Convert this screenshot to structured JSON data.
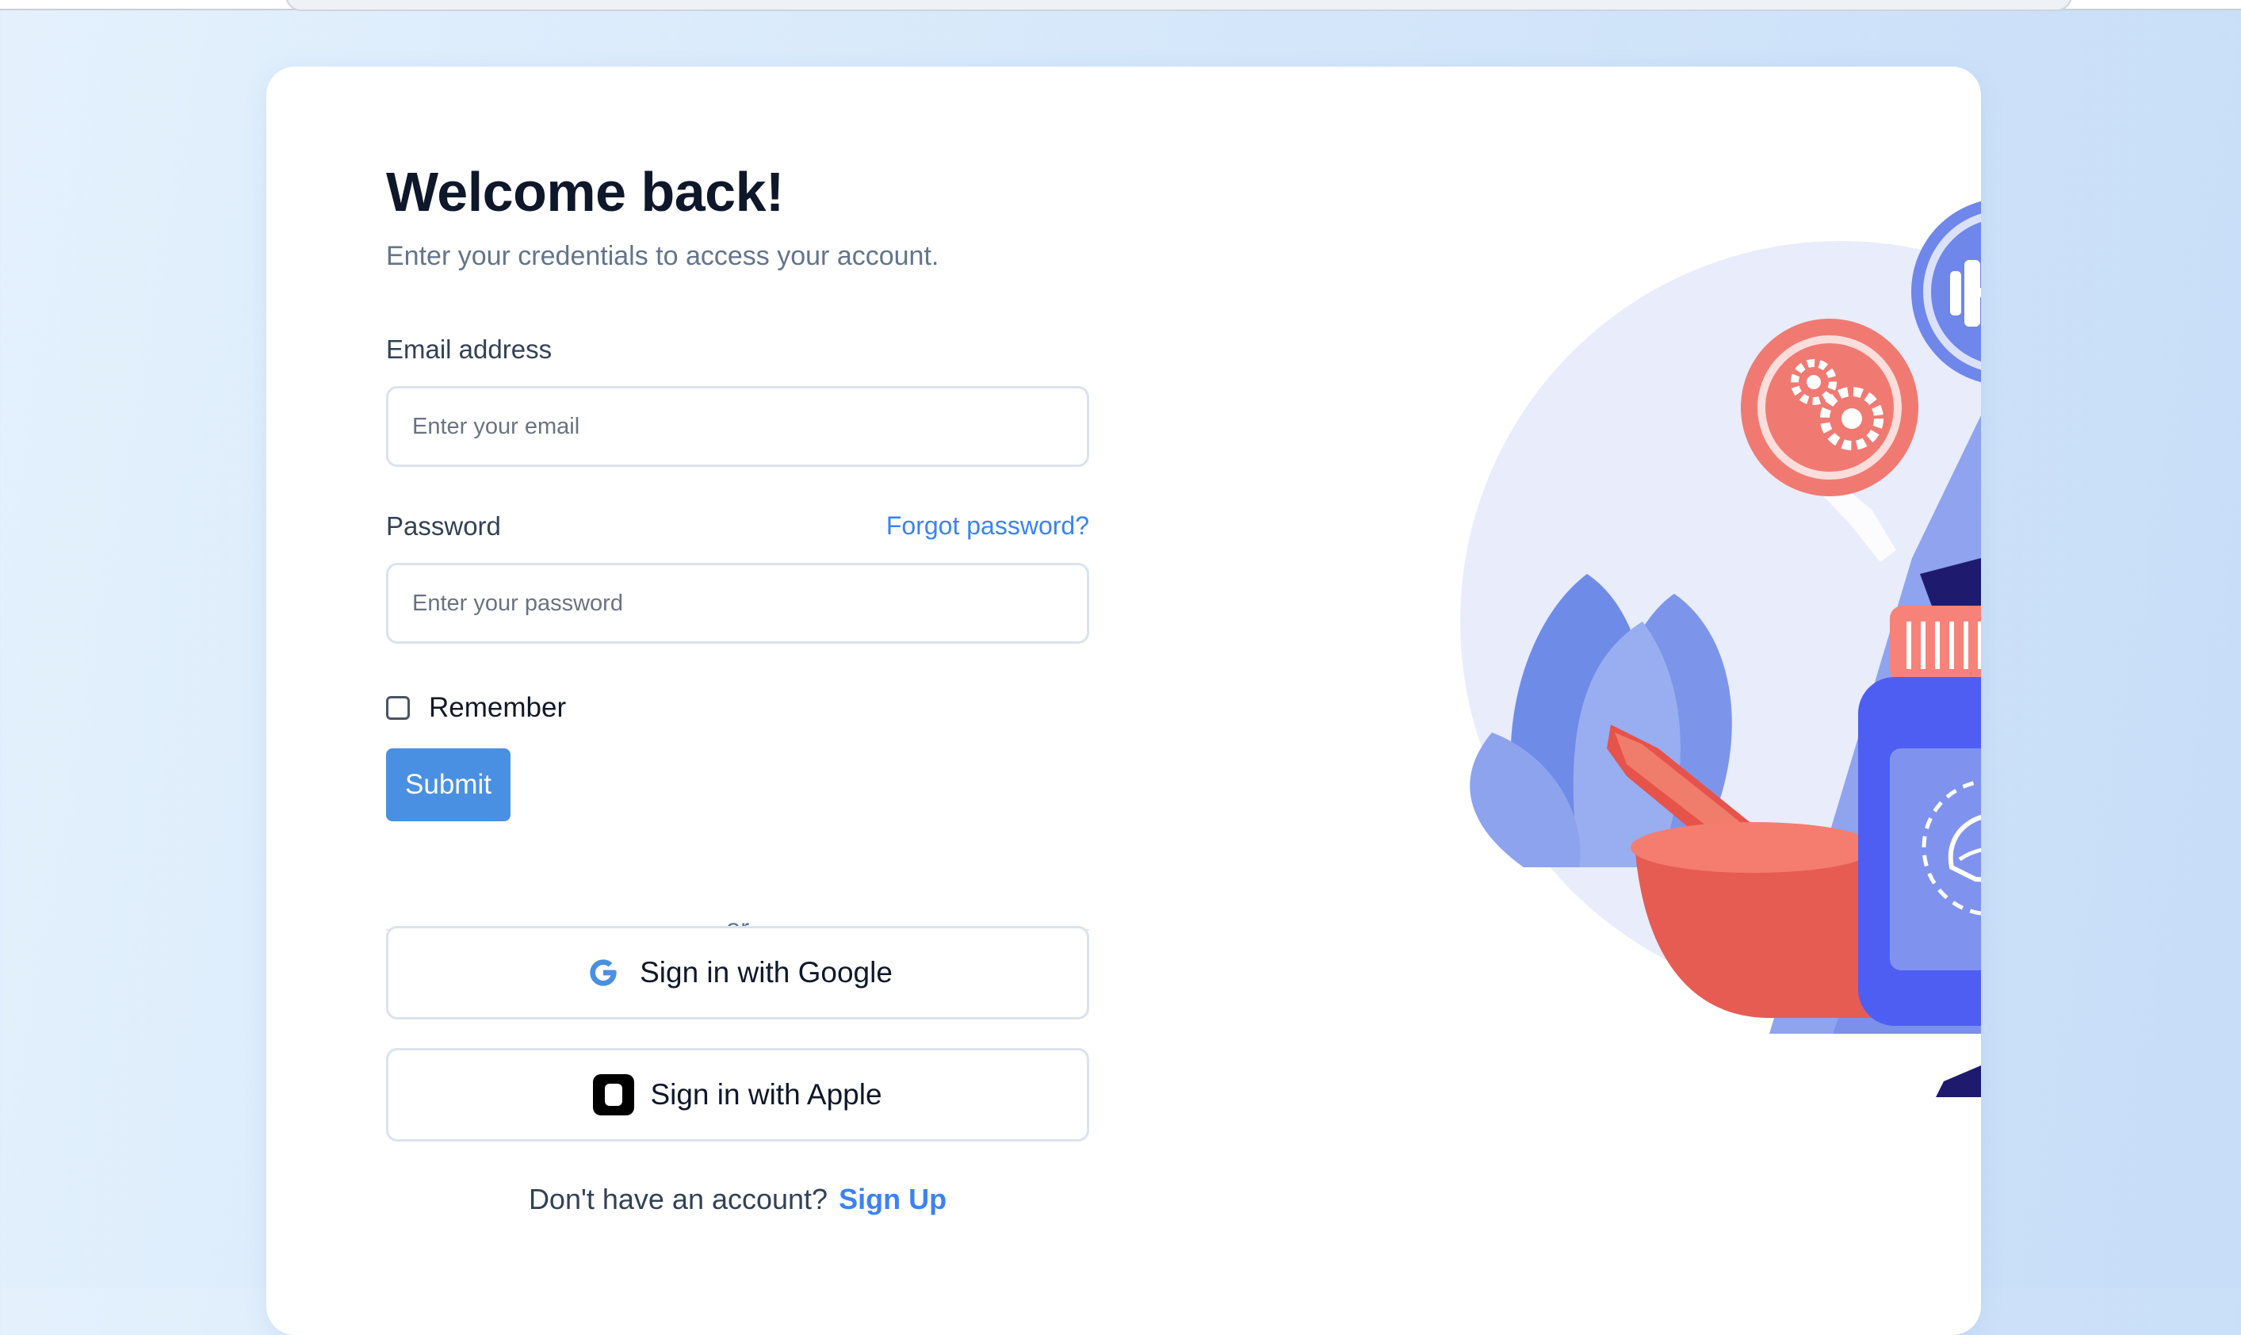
{
  "page": {
    "title": "Welcome back!",
    "subtitle": "Enter your credentials to access your account."
  },
  "form": {
    "email": {
      "label": "Email address",
      "placeholder": "Enter your email",
      "value": ""
    },
    "password": {
      "label": "Password",
      "placeholder": "Enter your password",
      "value": "",
      "forgot_link": "Forgot password?"
    },
    "remember": {
      "label": "Remember",
      "checked": false
    },
    "submit_label": "Submit",
    "divider_text": "or"
  },
  "social": {
    "google": {
      "label": "Sign in with Google",
      "icon": "google-icon"
    },
    "apple": {
      "label": "Sign in with Apple",
      "icon": "apple-icon"
    }
  },
  "signup": {
    "prompt": "Don't have an account?",
    "link": "Sign Up"
  },
  "illustration": {
    "icons": [
      "gears-icon",
      "dumbbell-icon",
      "heartbeat-icon",
      "leaf-icon"
    ]
  },
  "colors": {
    "accent": "#4a90e2",
    "link": "#3b82f6",
    "heading": "#0f172a",
    "background": "#d6e8fa"
  }
}
